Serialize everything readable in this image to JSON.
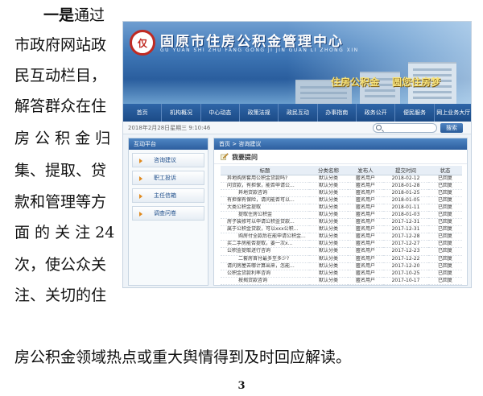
{
  "paragraph": {
    "lines": [
      {
        "lead": "一是",
        "rest": "通过"
      },
      {
        "lead": "",
        "rest": "市政府网站政"
      },
      {
        "lead": "",
        "rest": "民互动栏目，"
      },
      {
        "lead": "",
        "rest": "解答群众在住"
      },
      {
        "lead": "",
        "rest": "房 公 积 金 归"
      },
      {
        "lead": "",
        "rest": "集、提取、贷"
      },
      {
        "lead": "",
        "rest": "款和管理等方"
      },
      {
        "lead": "",
        "rest": "面 的 关 注  24"
      },
      {
        "lead": "",
        "rest": "次，使公众关"
      },
      {
        "lead": "",
        "rest": "注、关切的住"
      }
    ],
    "last_line": "房公积金领域热点或重大舆情得到及时回应解读。"
  },
  "page_number": "3",
  "website": {
    "logo_text": "仅",
    "title": "固原市住房公积金管理中心",
    "subtitle": "GU YUAN SHI ZHU FANG GONG JI JIN GUAN LI ZHONG XIN",
    "slogans": [
      "住房公积金",
      "圆您住房梦"
    ],
    "nav": [
      "首页",
      "机构概况",
      "中心动态",
      "政策法规",
      "政民互动",
      "办事指南",
      "政务公开",
      "便民服务",
      "网上业务大厅"
    ],
    "date_text": "2018年2月28日星期三 9:10:46",
    "search_button": "搜索",
    "sidebar": {
      "title": "互动平台",
      "items": [
        "咨询建议",
        "职工投诉",
        "主任信箱",
        "调查问卷"
      ]
    },
    "breadcrumb": "首页 > 咨询建议",
    "ask_label": "我要提问",
    "table": {
      "headers": [
        "标题",
        "分类名称",
        "发布人",
        "提交时间",
        "状态"
      ],
      "rows": [
        [
          "异地购房套用公积金贷款吗?",
          "默认分类",
          "匿名用户",
          "2018-02-12",
          "已回复"
        ],
        [
          "问贷款，有担保，能否申请公...",
          "默认分类",
          "匿名用户",
          "2018-01-28",
          "已回复"
        ],
        [
          "异地贷款咨询",
          "默认分类",
          "匿名用户",
          "2018-01-25",
          "已回复"
        ],
        [
          "有担保有保险，请问能否可以...",
          "默认分类",
          "匿名用户",
          "2018-01-05",
          "已回复"
        ],
        [
          "大类公积金提取",
          "默认分类",
          "匿名用户",
          "2018-01-11",
          "已回复"
        ],
        [
          "提取住房公积金",
          "默认分类",
          "匿名用户",
          "2018-01-03",
          "已回复"
        ],
        [
          "房子装修可以申请公积金贷款...",
          "默认分类",
          "匿名用户",
          "2017-12-31",
          "已回复"
        ],
        [
          "属于公积金贷款，可以xxx公积...",
          "默认分类",
          "匿名用户",
          "2017-12-31",
          "已回复"
        ],
        [
          "购房付全款后在能申请公积金...",
          "默认分类",
          "匿名用户",
          "2017-12-28",
          "已回复"
        ],
        [
          "买二手房能否提取，要一次x...",
          "默认分类",
          "匿名用户",
          "2017-12-27",
          "已回复"
        ],
        [
          "公积金提取进行咨询",
          "默认分类",
          "匿名用户",
          "2017-12-23",
          "已回复"
        ],
        [
          "二套房首付最多至多少?",
          "默认分类",
          "匿名用户",
          "2017-12-22",
          "已回复"
        ],
        [
          "请问房屋去哪计算出来，怎能...",
          "默认分类",
          "匿名用户",
          "2017-12-20",
          "已回复"
        ],
        [
          "公积金贷款利率咨询",
          "默认分类",
          "匿名用户",
          "2017-10-25",
          "已回复"
        ],
        [
          "按揭贷款咨询",
          "默认分类",
          "匿名用户",
          "2017-10-17",
          "已回复"
        ]
      ]
    }
  }
}
